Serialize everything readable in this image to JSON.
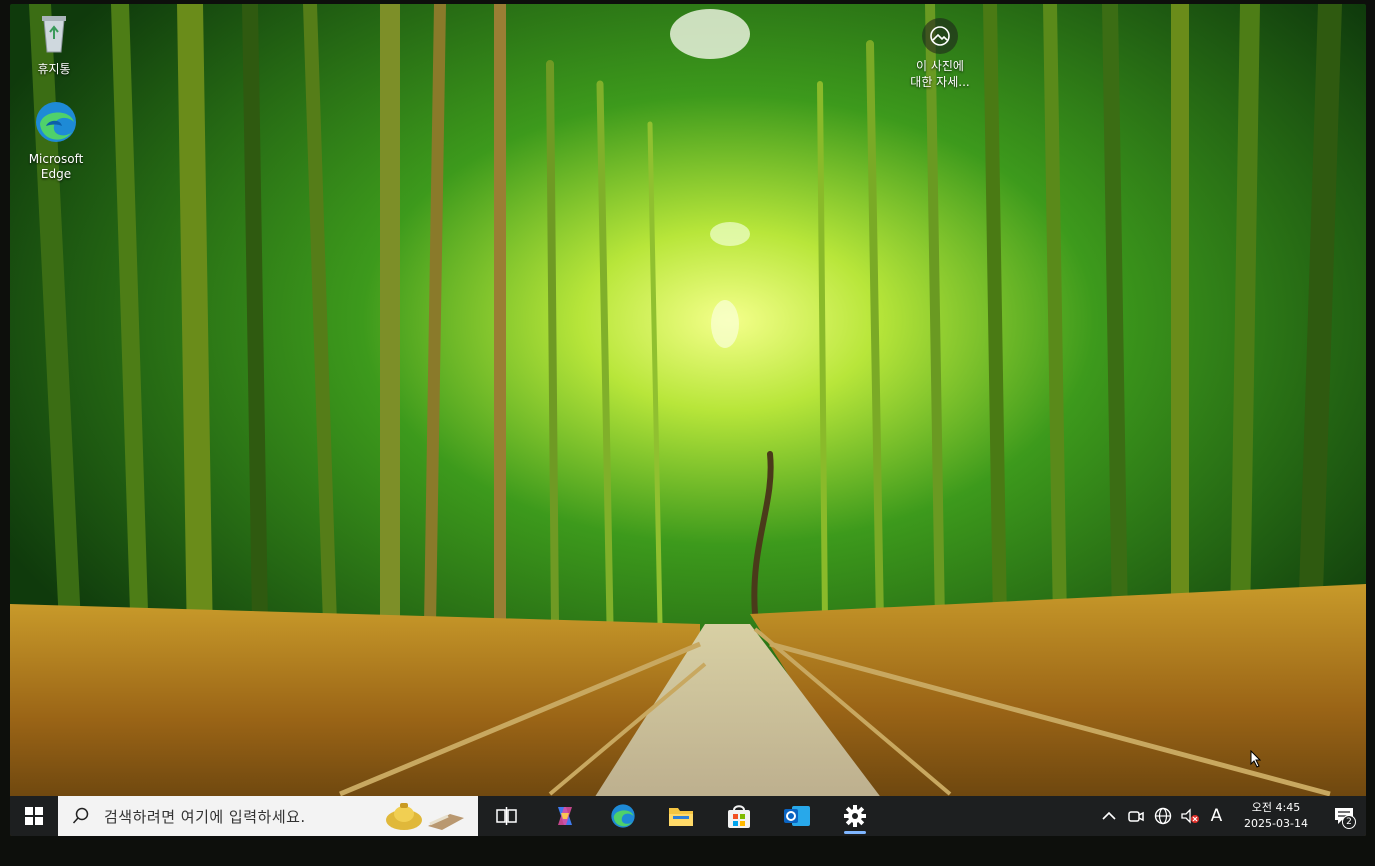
{
  "desktop": {
    "icons": [
      {
        "label": "휴지통",
        "icon": "recycle-bin-icon"
      },
      {
        "label_line1": "Microsoft",
        "label_line2": "Edge",
        "icon": "edge-icon"
      }
    ],
    "spotlight": {
      "line1": "이 사진에",
      "line2": "대한 자세...",
      "icon": "spotlight-icon"
    }
  },
  "taskbar": {
    "start_icon": "windows-start-icon",
    "search": {
      "placeholder": "검색하려면 여기에 입력하세요."
    },
    "apps": [
      {
        "name": "task-view",
        "icon": "task-view-icon"
      },
      {
        "name": "copilot",
        "icon": "copilot-icon"
      },
      {
        "name": "edge",
        "icon": "edge-icon"
      },
      {
        "name": "file-explorer",
        "icon": "folder-icon"
      },
      {
        "name": "microsoft-store",
        "icon": "store-icon"
      },
      {
        "name": "outlook",
        "icon": "outlook-icon"
      },
      {
        "name": "settings",
        "icon": "gear-icon",
        "active": true
      }
    ],
    "tray": {
      "ime": "A",
      "time": "오전 4:45",
      "date": "2025-03-14",
      "notification_count": "2"
    }
  },
  "colors": {
    "taskbar": "#1d1f20",
    "search_bg": "#f3f3f3",
    "accent": "#7fb6ff"
  }
}
